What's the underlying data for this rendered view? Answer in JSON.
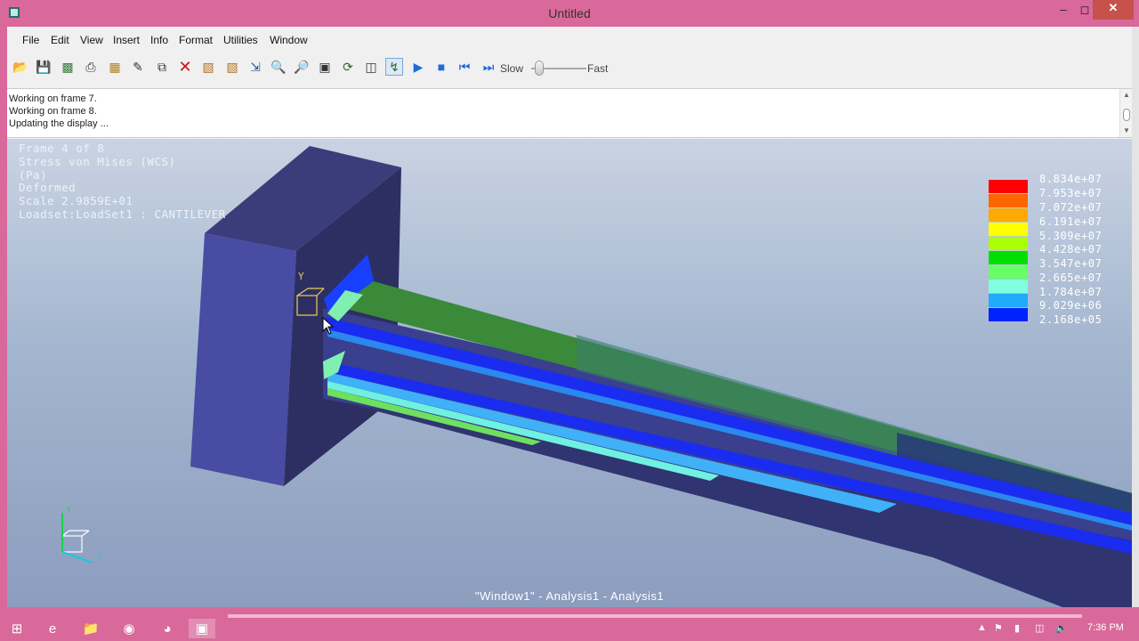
{
  "window": {
    "title": "Untitled"
  },
  "menu": [
    "File",
    "Edit",
    "View",
    "Insert",
    "Info",
    "Format",
    "Utilities",
    "Window"
  ],
  "toolbar": {
    "icons": [
      "open-icon",
      "save-icon",
      "import-icon",
      "print-icon",
      "tool-icon",
      "edit-icon",
      "copy-icon",
      "delete-icon",
      "info-icon",
      "info2-icon",
      "resize-icon",
      "zoom-in-icon",
      "zoom-out-icon",
      "refit-icon",
      "orient-icon",
      "spin-icon",
      "query-icon"
    ],
    "slow_label": "Slow",
    "fast_label": "Fast",
    "speed": 0.1
  },
  "messages": [
    "Working on frame 7.",
    "Working on frame 8.",
    "Updating the display ..."
  ],
  "viewport": {
    "info": [
      "Frame 4 of 8",
      "Stress von Mises (WCS)",
      "(Pa)",
      "Deformed",
      "Scale  2.9859E+01",
      "Loadset:LoadSet1 :  CANTILEVER"
    ],
    "status": "\"Window1\" - Analysis1 - Analysis1",
    "csys_label_y": "Y",
    "triad_y": "Y",
    "triad_z": "Z"
  },
  "legend": {
    "values": [
      "8.834e+07",
      "7.953e+07",
      "7.072e+07",
      "6.191e+07",
      "5.309e+07",
      "4.428e+07",
      "3.547e+07",
      "2.665e+07",
      "1.784e+07",
      "9.029e+06",
      "2.168e+05"
    ],
    "colors": [
      "#ff0000",
      "#ff6600",
      "#ffaa00",
      "#ffff00",
      "#aaff00",
      "#00e000",
      "#66ff66",
      "#80ffe0",
      "#22aaff",
      "#0022ff",
      "#2a2a7a"
    ]
  },
  "taskbar": {
    "time": "7:36 PM"
  }
}
